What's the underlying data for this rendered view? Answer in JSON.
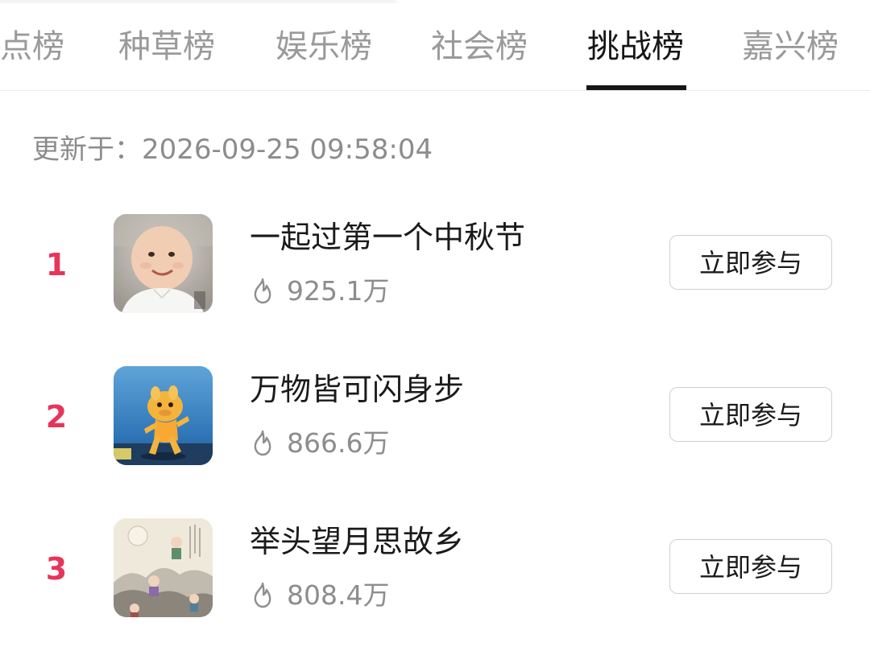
{
  "tabs": [
    {
      "label": "点榜",
      "active": false
    },
    {
      "label": "种草榜",
      "active": false
    },
    {
      "label": "娱乐榜",
      "active": false
    },
    {
      "label": "社会榜",
      "active": false
    },
    {
      "label": "挑战榜",
      "active": true
    },
    {
      "label": "嘉兴榜",
      "active": false
    }
  ],
  "updated_text": "更新于：2026-09-25 09:58:04",
  "colors": {
    "rank": "#e8345a",
    "active_tab": "#161616",
    "inactive_tab": "#9a9a9a"
  },
  "items": [
    {
      "rank": "1",
      "title": "一起过第一个中秋节",
      "heat": "925.1万",
      "button": "立即参与",
      "thumbnail": "baby-photo"
    },
    {
      "rank": "2",
      "title": "万物皆可闪身步",
      "heat": "866.6万",
      "button": "立即参与",
      "thumbnail": "dancing-cartoon"
    },
    {
      "rank": "3",
      "title": "举头望月思故乡",
      "heat": "808.4万",
      "button": "立即参与",
      "thumbnail": "ink-painting"
    }
  ],
  "icons": {
    "heat": "flame-icon"
  }
}
